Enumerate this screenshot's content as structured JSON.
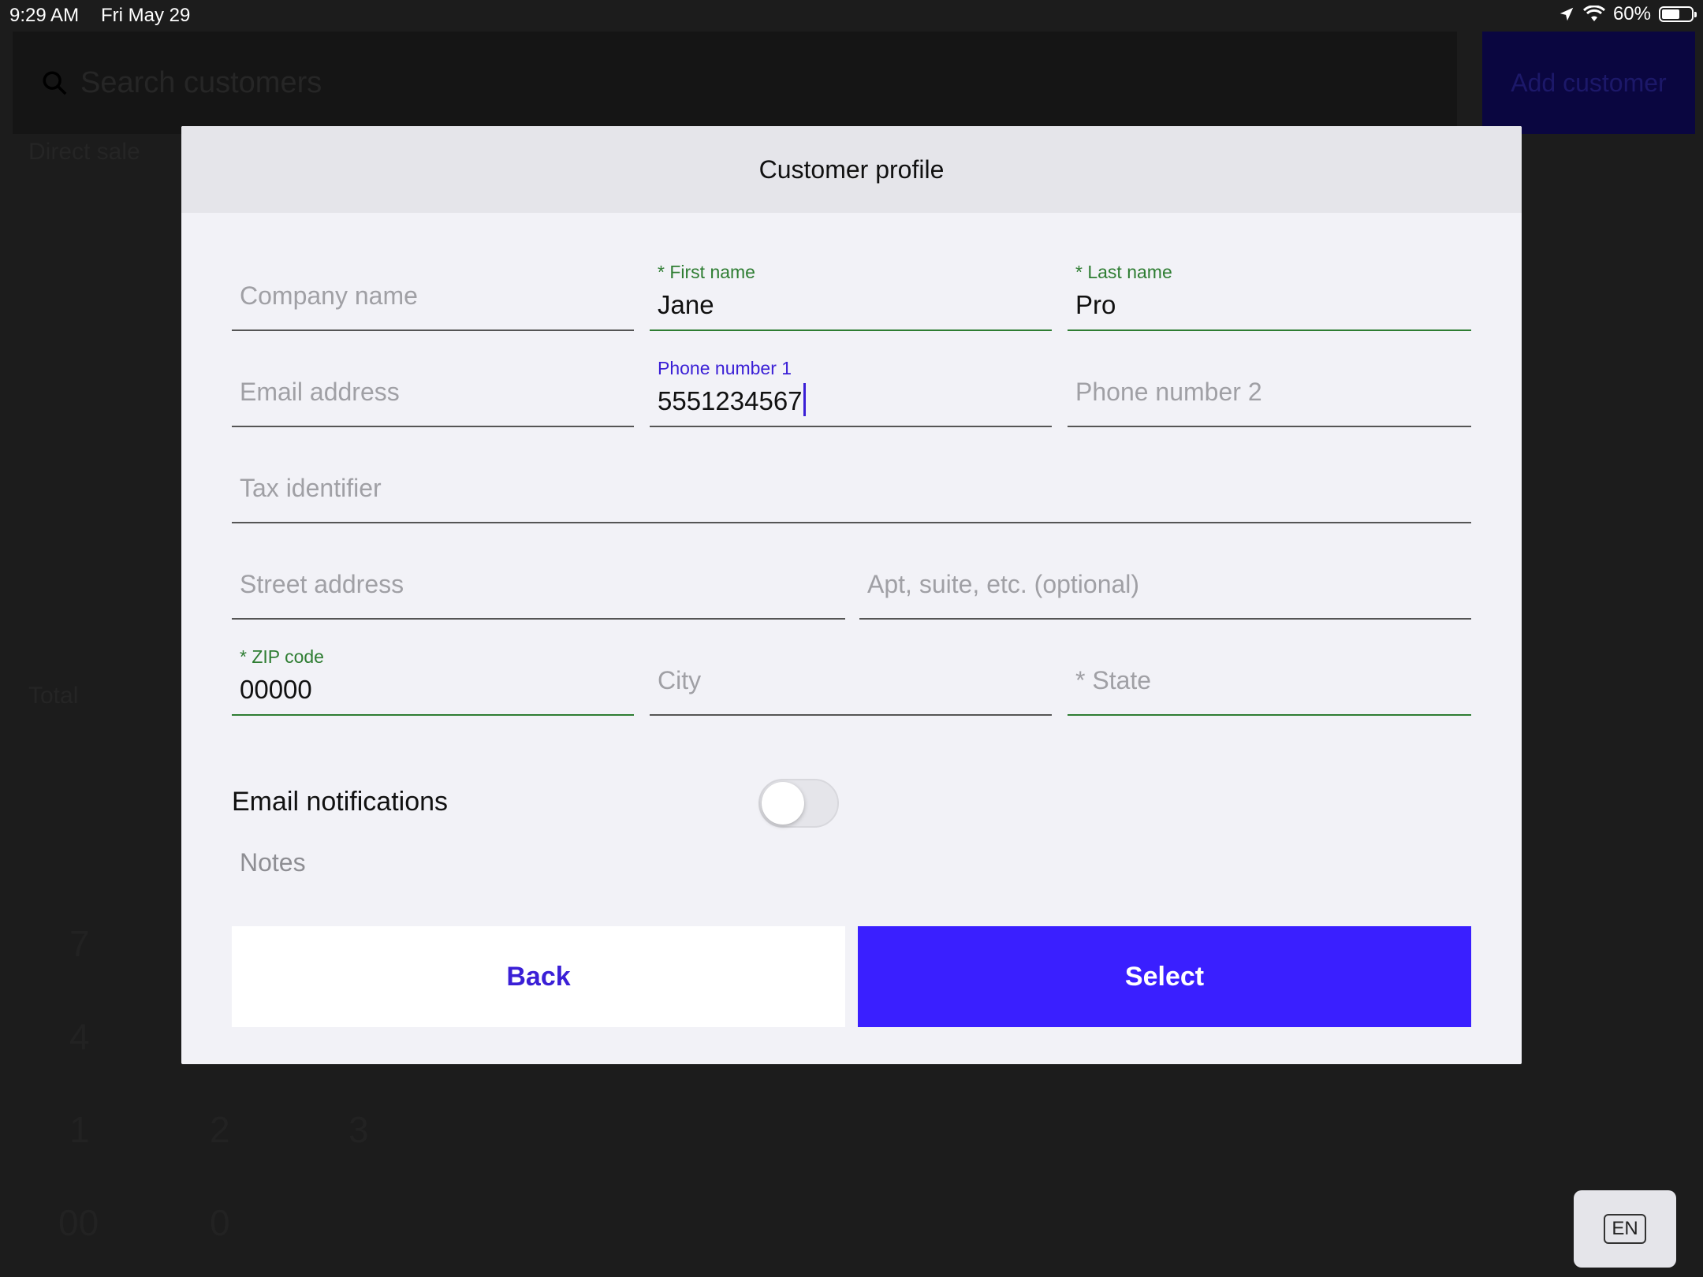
{
  "status_bar": {
    "time": "9:29 AM",
    "date": "Fri May 29",
    "battery": "60%",
    "battery_level": 0.6
  },
  "background": {
    "search_placeholder": "Search customers",
    "add_customer": "Add customer",
    "direct_sale": "Direct sale",
    "total": "Total",
    "keypad": [
      "7",
      "4",
      "1",
      "2",
      "3",
      "00",
      "0"
    ]
  },
  "modal": {
    "title": "Customer profile",
    "fields": {
      "company_name": {
        "placeholder": "Company name"
      },
      "first_name": {
        "label": "* First name",
        "value": "Jane"
      },
      "last_name": {
        "label": "* Last name",
        "value": "Pro"
      },
      "email": {
        "placeholder": "Email address"
      },
      "phone1": {
        "label": "Phone number 1",
        "value": "5551234567"
      },
      "phone2": {
        "placeholder": "Phone number 2"
      },
      "tax_id": {
        "placeholder": "Tax identifier"
      },
      "street": {
        "placeholder": "Street address"
      },
      "apt": {
        "placeholder": "Apt, suite, etc. (optional)"
      },
      "zip": {
        "label": "* ZIP code",
        "value": "00000"
      },
      "city": {
        "placeholder": "City"
      },
      "state": {
        "placeholder": "* State"
      }
    },
    "email_notifications": {
      "label": "Email notifications",
      "enabled": false
    },
    "notes_placeholder": "Notes",
    "back_label": "Back",
    "select_label": "Select"
  },
  "keyboard_language": "EN",
  "colors": {
    "accent": "#3a1fff",
    "valid_green": "#2e7d32",
    "overlay": "#1c1c1c"
  }
}
